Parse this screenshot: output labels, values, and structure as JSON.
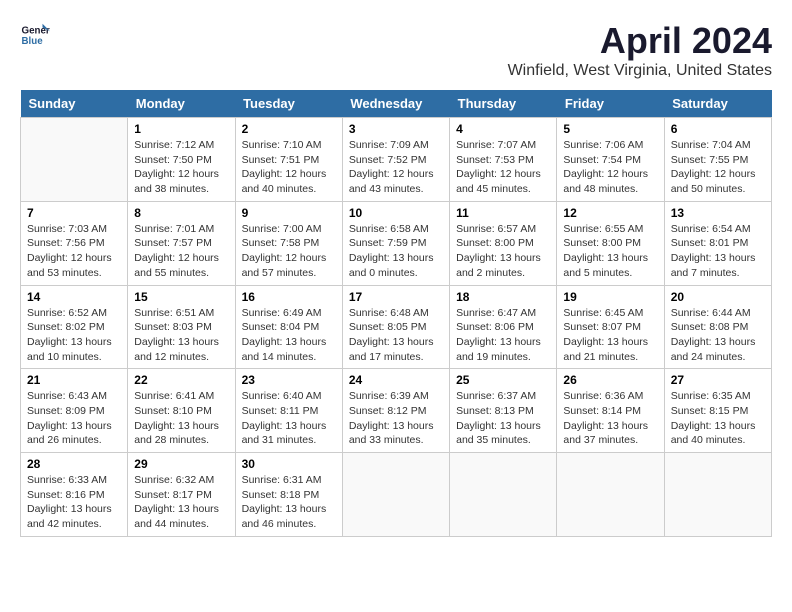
{
  "logo": {
    "line1": "General",
    "line2": "Blue"
  },
  "title": "April 2024",
  "subtitle": "Winfield, West Virginia, United States",
  "weekdays": [
    "Sunday",
    "Monday",
    "Tuesday",
    "Wednesday",
    "Thursday",
    "Friday",
    "Saturday"
  ],
  "weeks": [
    [
      {
        "day": "",
        "info": ""
      },
      {
        "day": "1",
        "info": "Sunrise: 7:12 AM\nSunset: 7:50 PM\nDaylight: 12 hours\nand 38 minutes."
      },
      {
        "day": "2",
        "info": "Sunrise: 7:10 AM\nSunset: 7:51 PM\nDaylight: 12 hours\nand 40 minutes."
      },
      {
        "day": "3",
        "info": "Sunrise: 7:09 AM\nSunset: 7:52 PM\nDaylight: 12 hours\nand 43 minutes."
      },
      {
        "day": "4",
        "info": "Sunrise: 7:07 AM\nSunset: 7:53 PM\nDaylight: 12 hours\nand 45 minutes."
      },
      {
        "day": "5",
        "info": "Sunrise: 7:06 AM\nSunset: 7:54 PM\nDaylight: 12 hours\nand 48 minutes."
      },
      {
        "day": "6",
        "info": "Sunrise: 7:04 AM\nSunset: 7:55 PM\nDaylight: 12 hours\nand 50 minutes."
      }
    ],
    [
      {
        "day": "7",
        "info": "Sunrise: 7:03 AM\nSunset: 7:56 PM\nDaylight: 12 hours\nand 53 minutes."
      },
      {
        "day": "8",
        "info": "Sunrise: 7:01 AM\nSunset: 7:57 PM\nDaylight: 12 hours\nand 55 minutes."
      },
      {
        "day": "9",
        "info": "Sunrise: 7:00 AM\nSunset: 7:58 PM\nDaylight: 12 hours\nand 57 minutes."
      },
      {
        "day": "10",
        "info": "Sunrise: 6:58 AM\nSunset: 7:59 PM\nDaylight: 13 hours\nand 0 minutes."
      },
      {
        "day": "11",
        "info": "Sunrise: 6:57 AM\nSunset: 8:00 PM\nDaylight: 13 hours\nand 2 minutes."
      },
      {
        "day": "12",
        "info": "Sunrise: 6:55 AM\nSunset: 8:00 PM\nDaylight: 13 hours\nand 5 minutes."
      },
      {
        "day": "13",
        "info": "Sunrise: 6:54 AM\nSunset: 8:01 PM\nDaylight: 13 hours\nand 7 minutes."
      }
    ],
    [
      {
        "day": "14",
        "info": "Sunrise: 6:52 AM\nSunset: 8:02 PM\nDaylight: 13 hours\nand 10 minutes."
      },
      {
        "day": "15",
        "info": "Sunrise: 6:51 AM\nSunset: 8:03 PM\nDaylight: 13 hours\nand 12 minutes."
      },
      {
        "day": "16",
        "info": "Sunrise: 6:49 AM\nSunset: 8:04 PM\nDaylight: 13 hours\nand 14 minutes."
      },
      {
        "day": "17",
        "info": "Sunrise: 6:48 AM\nSunset: 8:05 PM\nDaylight: 13 hours\nand 17 minutes."
      },
      {
        "day": "18",
        "info": "Sunrise: 6:47 AM\nSunset: 8:06 PM\nDaylight: 13 hours\nand 19 minutes."
      },
      {
        "day": "19",
        "info": "Sunrise: 6:45 AM\nSunset: 8:07 PM\nDaylight: 13 hours\nand 21 minutes."
      },
      {
        "day": "20",
        "info": "Sunrise: 6:44 AM\nSunset: 8:08 PM\nDaylight: 13 hours\nand 24 minutes."
      }
    ],
    [
      {
        "day": "21",
        "info": "Sunrise: 6:43 AM\nSunset: 8:09 PM\nDaylight: 13 hours\nand 26 minutes."
      },
      {
        "day": "22",
        "info": "Sunrise: 6:41 AM\nSunset: 8:10 PM\nDaylight: 13 hours\nand 28 minutes."
      },
      {
        "day": "23",
        "info": "Sunrise: 6:40 AM\nSunset: 8:11 PM\nDaylight: 13 hours\nand 31 minutes."
      },
      {
        "day": "24",
        "info": "Sunrise: 6:39 AM\nSunset: 8:12 PM\nDaylight: 13 hours\nand 33 minutes."
      },
      {
        "day": "25",
        "info": "Sunrise: 6:37 AM\nSunset: 8:13 PM\nDaylight: 13 hours\nand 35 minutes."
      },
      {
        "day": "26",
        "info": "Sunrise: 6:36 AM\nSunset: 8:14 PM\nDaylight: 13 hours\nand 37 minutes."
      },
      {
        "day": "27",
        "info": "Sunrise: 6:35 AM\nSunset: 8:15 PM\nDaylight: 13 hours\nand 40 minutes."
      }
    ],
    [
      {
        "day": "28",
        "info": "Sunrise: 6:33 AM\nSunset: 8:16 PM\nDaylight: 13 hours\nand 42 minutes."
      },
      {
        "day": "29",
        "info": "Sunrise: 6:32 AM\nSunset: 8:17 PM\nDaylight: 13 hours\nand 44 minutes."
      },
      {
        "day": "30",
        "info": "Sunrise: 6:31 AM\nSunset: 8:18 PM\nDaylight: 13 hours\nand 46 minutes."
      },
      {
        "day": "",
        "info": ""
      },
      {
        "day": "",
        "info": ""
      },
      {
        "day": "",
        "info": ""
      },
      {
        "day": "",
        "info": ""
      }
    ]
  ]
}
